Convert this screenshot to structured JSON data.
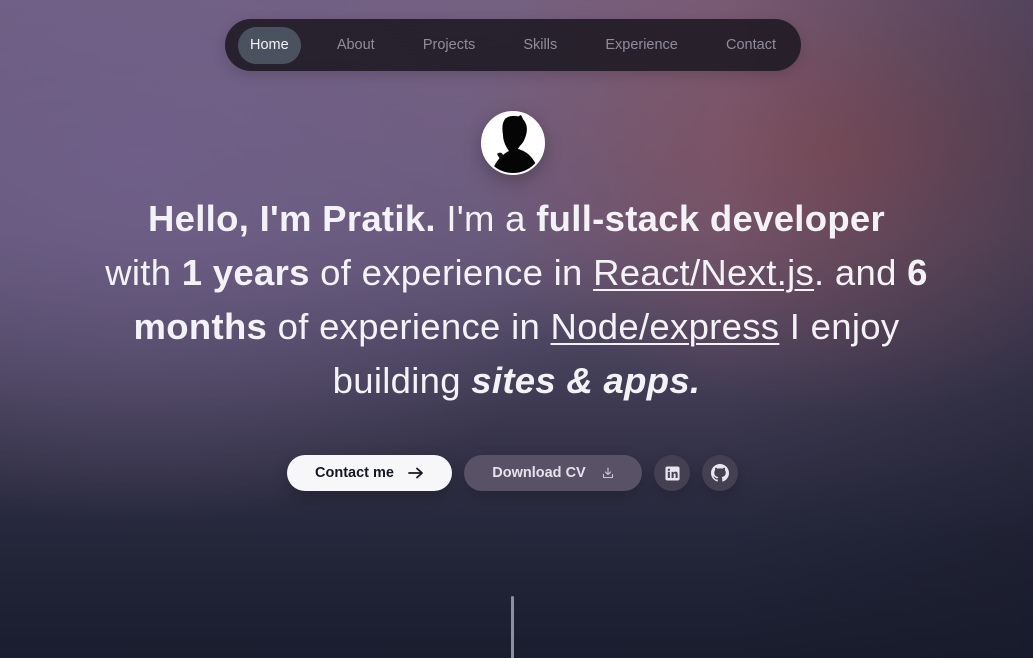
{
  "nav": {
    "items": [
      {
        "label": "Home",
        "active": true
      },
      {
        "label": "About",
        "active": false
      },
      {
        "label": "Projects",
        "active": false
      },
      {
        "label": "Skills",
        "active": false
      },
      {
        "label": "Experience",
        "active": false
      },
      {
        "label": "Contact",
        "active": false
      }
    ]
  },
  "avatar": {
    "icon": "profile-photo-avatar"
  },
  "hero": {
    "greeting": "Hello, I'm Pratik.",
    "im_a": " I'm a ",
    "role": "full-stack developer",
    "with": "with ",
    "years": "1 years",
    "of_exp_1": " of experience in ",
    "react_link": "React/Next.js",
    "period_and": ". and ",
    "months": "6 months",
    "of_exp_2": " of experience in ",
    "node_link": "Node/express",
    "enjoy": " I enjoy building ",
    "sites_apps": "sites & apps."
  },
  "actions": {
    "contact_label": "Contact me",
    "cv_label": "Download CV",
    "contact_icon": "arrow-right-icon",
    "cv_icon": "download-icon",
    "linkedin_icon": "linkedin-icon",
    "github_icon": "github-icon"
  },
  "colors": {
    "active_tab_bg": "#4a5260",
    "nav_bg": "#1c1922",
    "primary_button_bg": "#f7f7f9",
    "secondary_button_bg": "#5c5468"
  }
}
